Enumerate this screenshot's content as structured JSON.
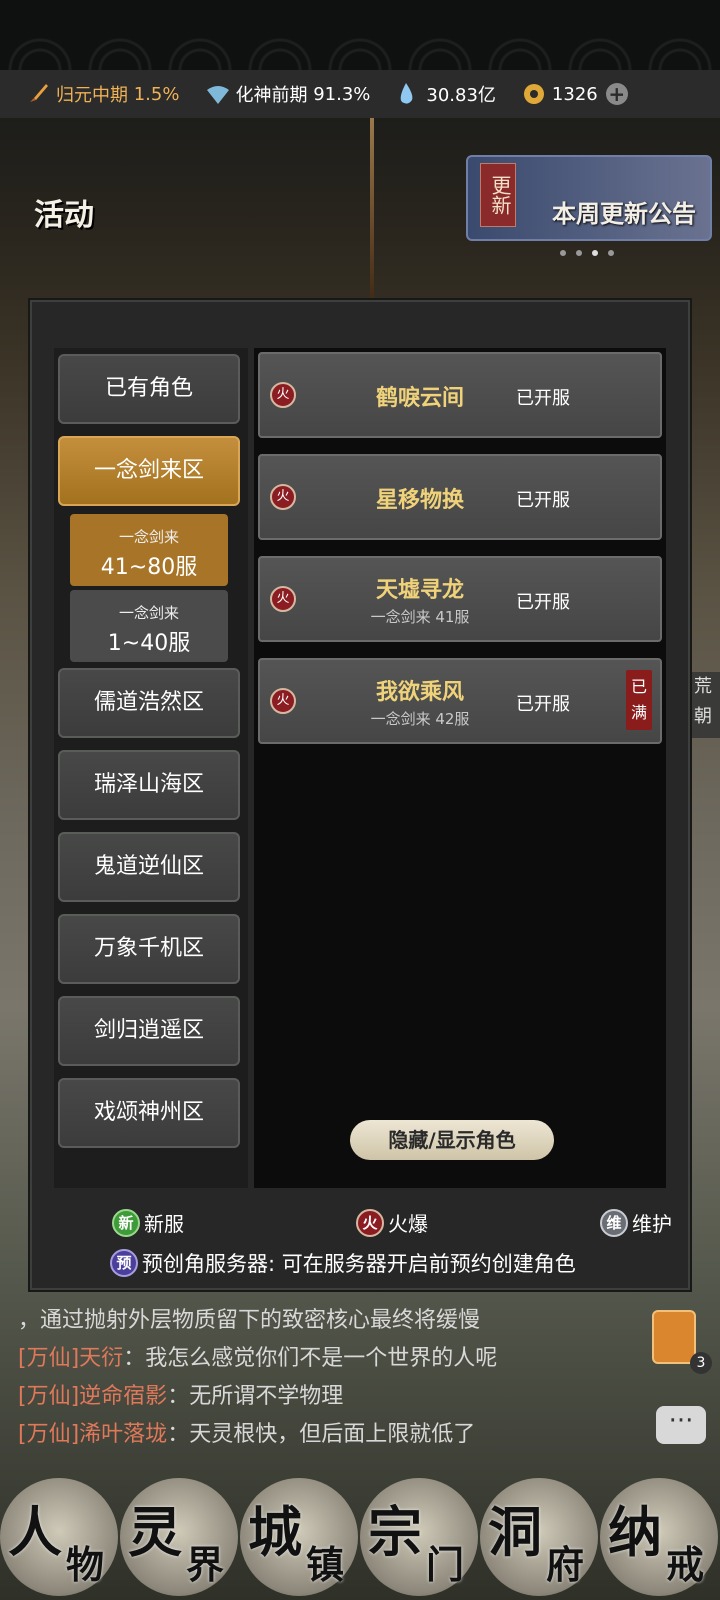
{
  "status_bar": {
    "realm_label": "归元中期",
    "realm_pct": "1.5%",
    "spirit_label": "化神前期",
    "spirit_pct": "91.3%",
    "stones": "30.83亿",
    "jade": "1326"
  },
  "background": {
    "activity_label": "活动",
    "notice_tag": "更新",
    "notice_text": "本周更新公告",
    "right_side_label": "荒朝"
  },
  "zones": [
    {
      "label": "已有角色",
      "active": false
    },
    {
      "label": "一念剑来区",
      "active": true
    },
    {
      "label": "儒道浩然区",
      "active": false
    },
    {
      "label": "瑞泽山海区",
      "active": false
    },
    {
      "label": "鬼道逆仙区",
      "active": false
    },
    {
      "label": "万象千机区",
      "active": false
    },
    {
      "label": "剑归逍遥区",
      "active": false
    },
    {
      "label": "戏颂神州区",
      "active": false
    }
  ],
  "subzones": [
    {
      "line1": "一念剑来",
      "line2": "41~80服",
      "active": true
    },
    {
      "line1": "一念剑来",
      "line2": "1~40服",
      "active": false
    }
  ],
  "servers": [
    {
      "name": "鹤唳云间",
      "note": "",
      "status": "已开服",
      "badge": "火",
      "full": ""
    },
    {
      "name": "星移物换",
      "note": "",
      "status": "已开服",
      "badge": "火",
      "full": ""
    },
    {
      "name": "天墟寻龙",
      "note": "一念剑来 41服",
      "status": "已开服",
      "badge": "火",
      "full": ""
    },
    {
      "name": "我欲乘风",
      "note": "一念剑来 42服",
      "status": "已开服",
      "badge": "火",
      "full": "已满"
    }
  ],
  "toggle_label": "隐藏/显示角色",
  "legend": {
    "new_badge": "新",
    "new_label": "新服",
    "hot_badge": "火",
    "hot_label": "火爆",
    "mt_badge": "维",
    "mt_label": "维护",
    "pre_badge": "预",
    "pre_text": "预创角服务器: 可在服务器开启前预约创建角色"
  },
  "chat": [
    {
      "channel": "",
      "name": "",
      "text": "，通过抛射外层物质留下的致密核心最终将缓慢"
    },
    {
      "channel": "[万仙]",
      "name": "天衍",
      "text": "：我怎么感觉你们不是一个世界的人呢"
    },
    {
      "channel": "[万仙]",
      "name": "逆命宿影",
      "text": "：无所谓不学物理"
    },
    {
      "channel": "[万仙]",
      "name": "浠叶落垅",
      "text": "：天灵根快，但后面上限就低了"
    }
  ],
  "gift_count": "3",
  "chat_button_icon": "···",
  "nav": [
    {
      "a": "人",
      "b": "物"
    },
    {
      "a": "灵",
      "b": "界"
    },
    {
      "a": "城",
      "b": "镇"
    },
    {
      "a": "宗",
      "b": "门"
    },
    {
      "a": "洞",
      "b": "府"
    },
    {
      "a": "纳",
      "b": "戒"
    }
  ]
}
